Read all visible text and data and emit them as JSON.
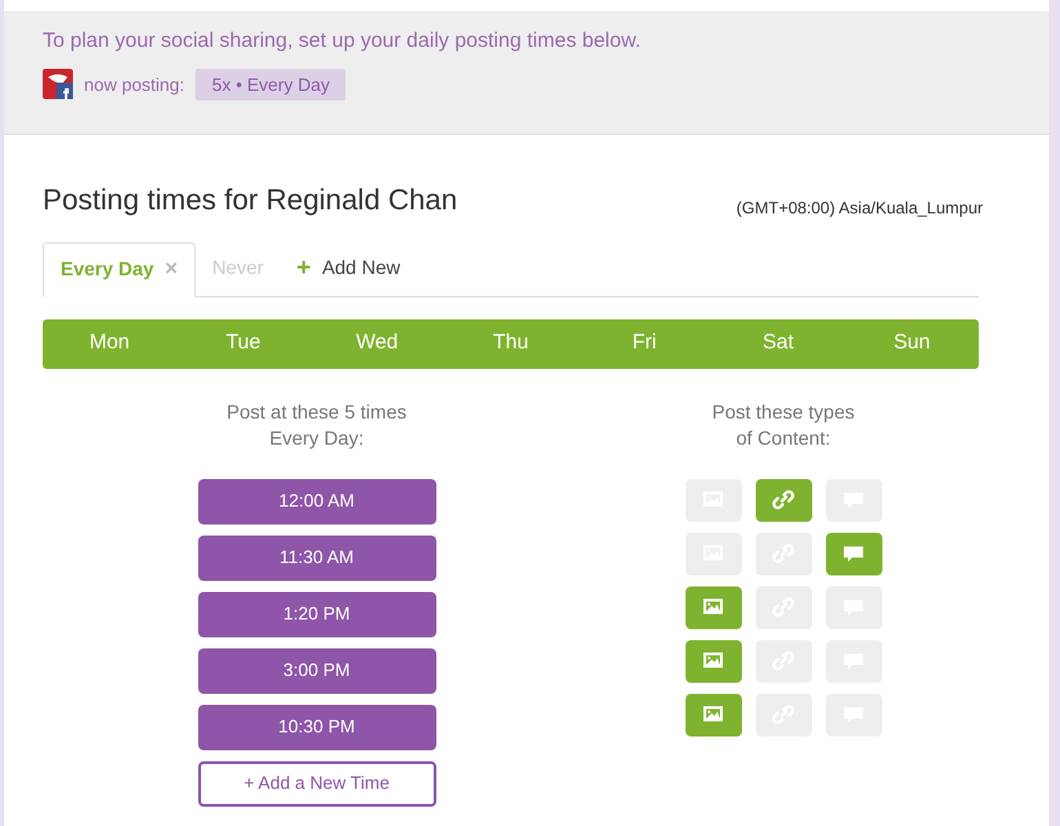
{
  "header": {
    "intro": "To plan your social sharing, set up your daily posting times below.",
    "now_posting_label": "now posting:",
    "schedule_badge": "5x • Every Day"
  },
  "title": "Posting times for Reginald Chan",
  "timezone": "(GMT+08:00) Asia/Kuala_Lumpur",
  "tabs": [
    {
      "label": "Every Day",
      "selected": true,
      "close": "×"
    },
    {
      "label": "Never",
      "selected": false
    }
  ],
  "add_tab": {
    "icon": "+",
    "label": "Add New"
  },
  "days": [
    "Mon",
    "Tue",
    "Wed",
    "Thu",
    "Fri",
    "Sat",
    "Sun"
  ],
  "times_heading": [
    "Post at these 5 times",
    "Every Day:"
  ],
  "content_heading": [
    "Post these types",
    "of Content:"
  ],
  "slots": [
    {
      "time": "12:00 AM",
      "content": [
        {
          "kind": "image",
          "selected": false
        },
        {
          "kind": "link",
          "selected": true
        },
        {
          "kind": "comment",
          "selected": false
        }
      ]
    },
    {
      "time": "11:30 AM",
      "content": [
        {
          "kind": "image",
          "selected": false
        },
        {
          "kind": "link",
          "selected": false
        },
        {
          "kind": "comment",
          "selected": true
        }
      ]
    },
    {
      "time": "1:20 PM",
      "content": [
        {
          "kind": "image",
          "selected": true
        },
        {
          "kind": "link",
          "selected": false
        },
        {
          "kind": "comment",
          "selected": false
        }
      ]
    },
    {
      "time": "3:00 PM",
      "content": [
        {
          "kind": "image",
          "selected": true
        },
        {
          "kind": "link",
          "selected": false
        },
        {
          "kind": "comment",
          "selected": false
        }
      ]
    },
    {
      "time": "10:30 PM",
      "content": [
        {
          "kind": "image",
          "selected": true
        },
        {
          "kind": "link",
          "selected": false
        },
        {
          "kind": "comment",
          "selected": false
        }
      ]
    }
  ],
  "add_time_button": "+ Add a New Time"
}
